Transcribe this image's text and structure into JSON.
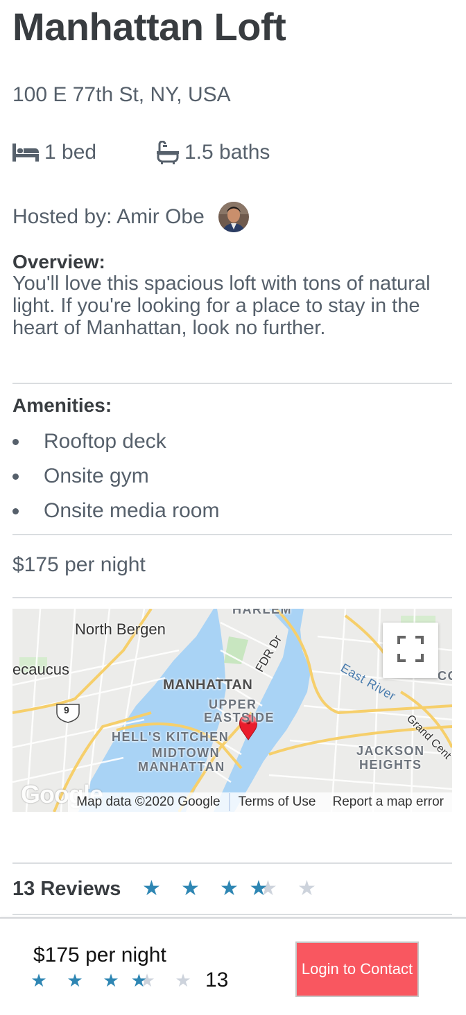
{
  "listing": {
    "title": "Manhattan Loft",
    "address": "100 E 77th St, NY, USA",
    "beds": "1 bed",
    "baths": "1.5 baths",
    "host_label": "Hosted by: Amir Obe",
    "overview_heading": "Overview:",
    "overview_text": "You'll love this spacious loft with tons of natural light. If you're looking for a place to stay in the heart of Manhattan, look no further.",
    "amenities_heading": "Amenities:",
    "amenities": [
      "Rooftop deck",
      "Onsite gym",
      "Onsite media room"
    ],
    "price": "$175 per night"
  },
  "map": {
    "labels": {
      "north_bergen": "North Bergen",
      "secaucus": "ecaucus",
      "harlem": "HARLEM",
      "manhattan": "MANHATTAN",
      "upper": "UPPER",
      "east_side": "EASTSIDE",
      "hells_kitchen": "HELL'S KITCHEN",
      "midtown": "MIDTOWN",
      "midtown_manhattan": "MANHATTAN",
      "jackson": "JACKSON",
      "heights": "HEIGHTS",
      "fdr": "FDR Dr",
      "east_river": "East River",
      "grand": "Grand Cent",
      "route": "9",
      "coli": "COLI"
    },
    "logo": "Google",
    "attribution": "Map data ©2020 Google",
    "terms": "Terms of Use",
    "report": "Report a map error"
  },
  "reviews": {
    "label": "13 Reviews",
    "rating": 3.5,
    "max": 5
  },
  "bottom_bar": {
    "price": "$175 per night",
    "review_count": "13",
    "button_label": "Login to Contact"
  },
  "colors": {
    "star_filled": "#2e86b3",
    "star_empty": "#cdd3dc",
    "button": "#f95760",
    "map_water": "#a9d3f5",
    "map_pin": "#ea1c2b"
  },
  "icons": {
    "bed": "bed-icon",
    "bath": "bathtub-icon",
    "fullscreen": "fullscreen-icon",
    "pin": "map-pin-icon",
    "star": "star-icon"
  }
}
